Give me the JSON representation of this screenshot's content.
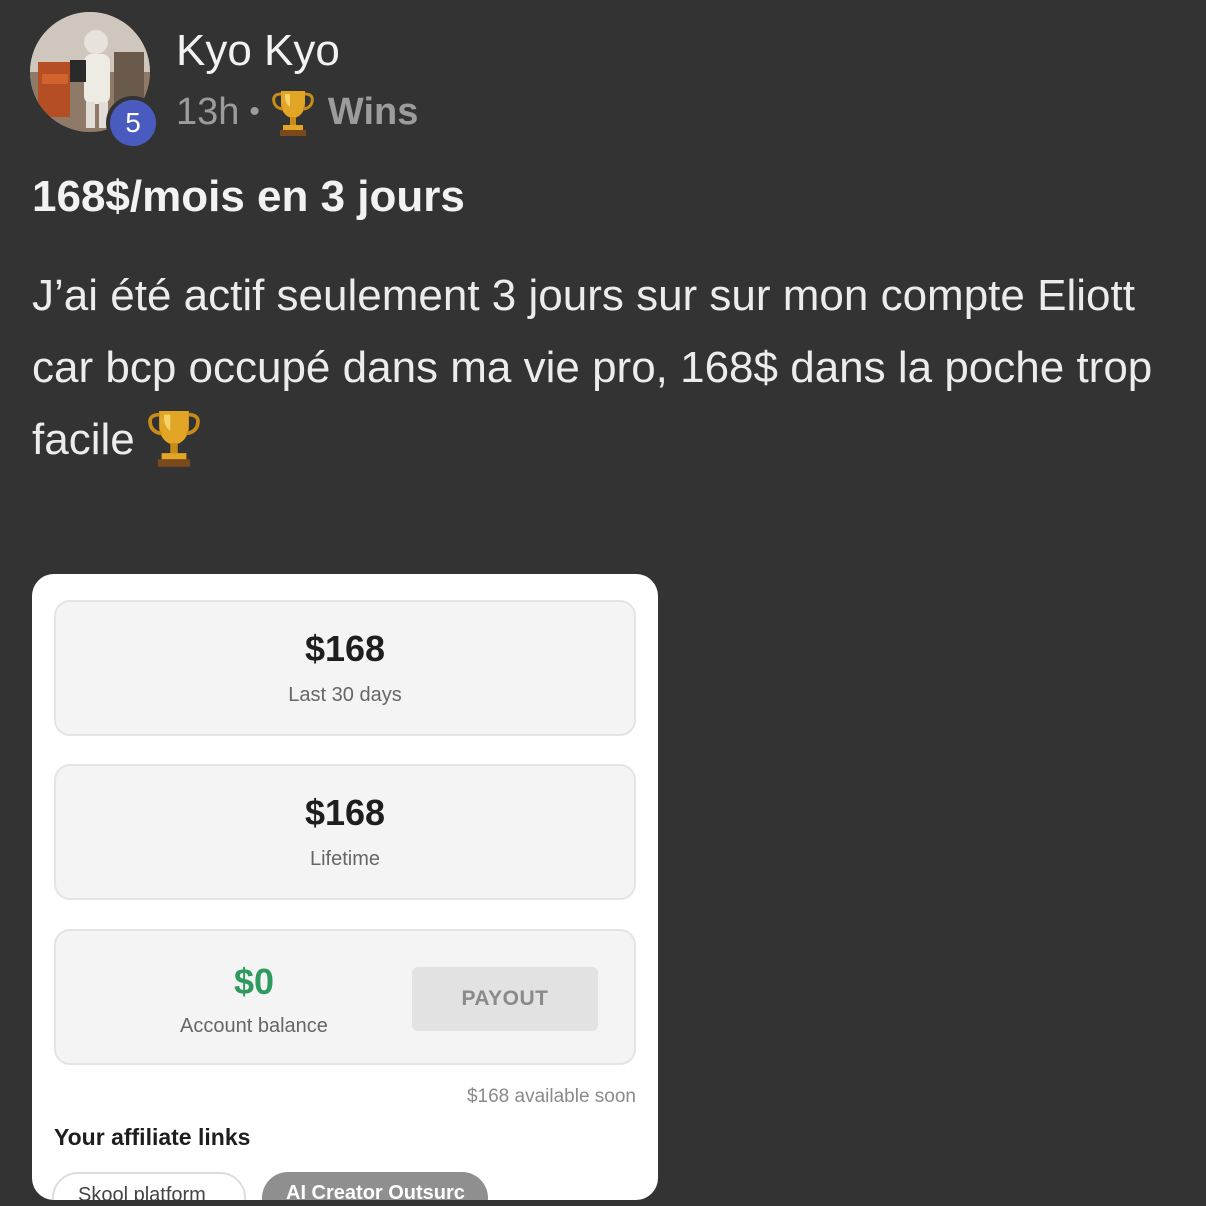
{
  "post": {
    "author": {
      "name": "Kyo Kyo",
      "level": "5",
      "avatar_icon": "user-avatar-photo"
    },
    "meta": {
      "time": "13h",
      "separator": "•",
      "category_icon": "trophy-icon",
      "category": "Wins"
    },
    "title": "168$/mois en 3 jours",
    "body": "J’ai été actif seulement 3 jours sur sur mon compte Eliott car bcp occupé dans ma vie pro, 168$ dans la poche trop facile",
    "body_trailing_icon": "trophy-icon"
  },
  "screenshot": {
    "last30": {
      "value": "$168",
      "label": "Last 30 days"
    },
    "lifetime": {
      "value": "$168",
      "label": "Lifetime"
    },
    "balance": {
      "value": "$0",
      "label": "Account balance",
      "value_color": "#2e9a5e"
    },
    "payout_button": "PAYOUT",
    "available_note": "$168 available soon",
    "affiliate_heading": "Your affiliate links",
    "affiliate_chips": [
      "Skool platform",
      "AI Creator Outsurc"
    ]
  },
  "colors": {
    "background": "#333333",
    "level_badge": "#4a5bbf",
    "muted_text": "#9c9c9c"
  }
}
